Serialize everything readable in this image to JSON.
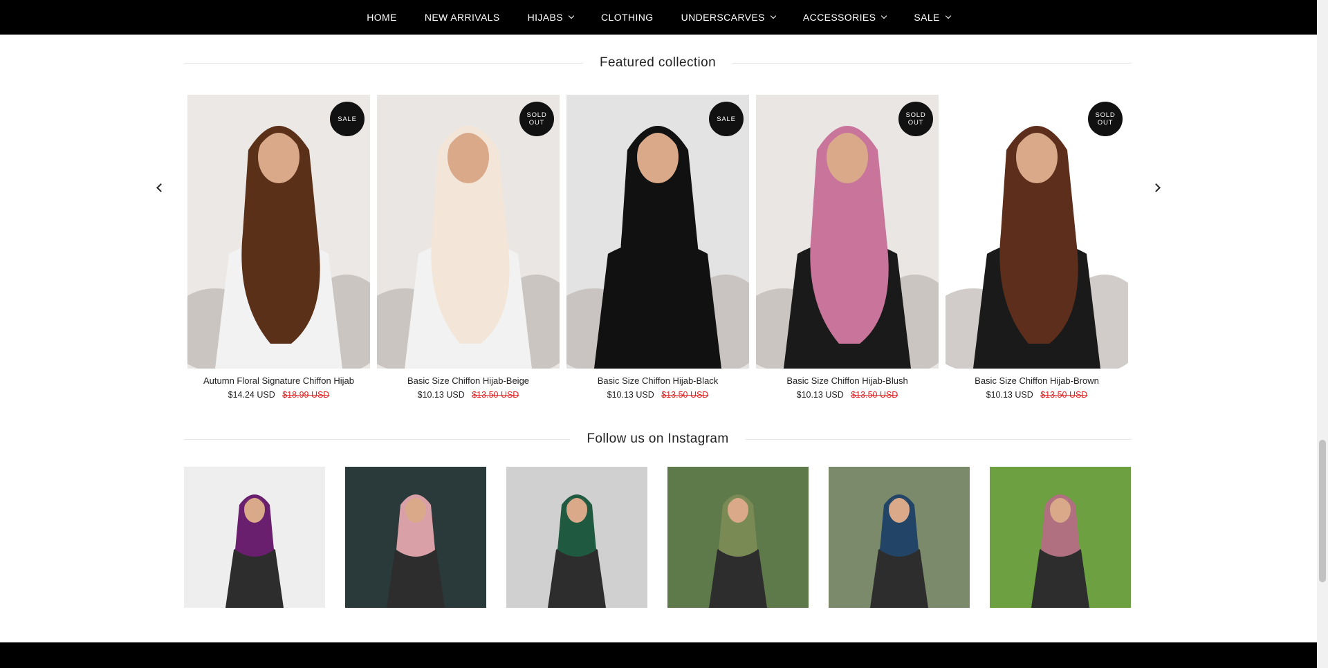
{
  "nav": {
    "items": [
      {
        "label": "HOME",
        "dropdown": false
      },
      {
        "label": "NEW ARRIVALS",
        "dropdown": false
      },
      {
        "label": "HIJABS",
        "dropdown": true
      },
      {
        "label": "CLOTHING",
        "dropdown": false
      },
      {
        "label": "UNDERSCARVES",
        "dropdown": true
      },
      {
        "label": "ACCESSORIES",
        "dropdown": true
      },
      {
        "label": "SALE",
        "dropdown": true
      }
    ]
  },
  "featured": {
    "title": "Featured collection",
    "products": [
      {
        "title": "Autumn Floral Signature Chiffon Hijab",
        "price": "$14.24 USD",
        "compare_price": "$18.99 USD",
        "badge": "SALE",
        "scarf_color": "#5a3018"
      },
      {
        "title": "Basic Size Chiffon Hijab-Beige",
        "price": "$10.13 USD",
        "compare_price": "$13.50 USD",
        "badge": "SOLD\nOUT",
        "scarf_color": "#f3e6d8"
      },
      {
        "title": "Basic Size Chiffon Hijab-Black",
        "price": "$10.13 USD",
        "compare_price": "$13.50 USD",
        "badge": "SALE",
        "scarf_color": "#111111"
      },
      {
        "title": "Basic Size Chiffon Hijab-Blush",
        "price": "$10.13 USD",
        "compare_price": "$13.50 USD",
        "badge": "SOLD\nOUT",
        "scarf_color": "#c9749a"
      },
      {
        "title": "Basic Size Chiffon Hijab-Brown",
        "price": "$10.13 USD",
        "compare_price": "$13.50 USD",
        "badge": "SOLD\nOUT",
        "scarf_color": "#5e2e1c"
      }
    ]
  },
  "instagram": {
    "title": "Follow us on Instagram",
    "tiles": [
      {
        "scarf_color": "#6a1f6e",
        "bg_color": "#eeeeee"
      },
      {
        "scarf_color": "#d9a0a8",
        "bg_color": "#2a3a3a"
      },
      {
        "scarf_color": "#1f5a40",
        "bg_color": "#d0d0d0"
      },
      {
        "scarf_color": "#7a8a55",
        "bg_color": "#5f7a4a"
      },
      {
        "scarf_color": "#224466",
        "bg_color": "#7a8a6a"
      },
      {
        "scarf_color": "#b07080",
        "bg_color": "#6ca040"
      }
    ]
  },
  "colors": {
    "nav_bg": "#000000",
    "sale_price": "#e02020",
    "badge_bg": "#111111"
  }
}
